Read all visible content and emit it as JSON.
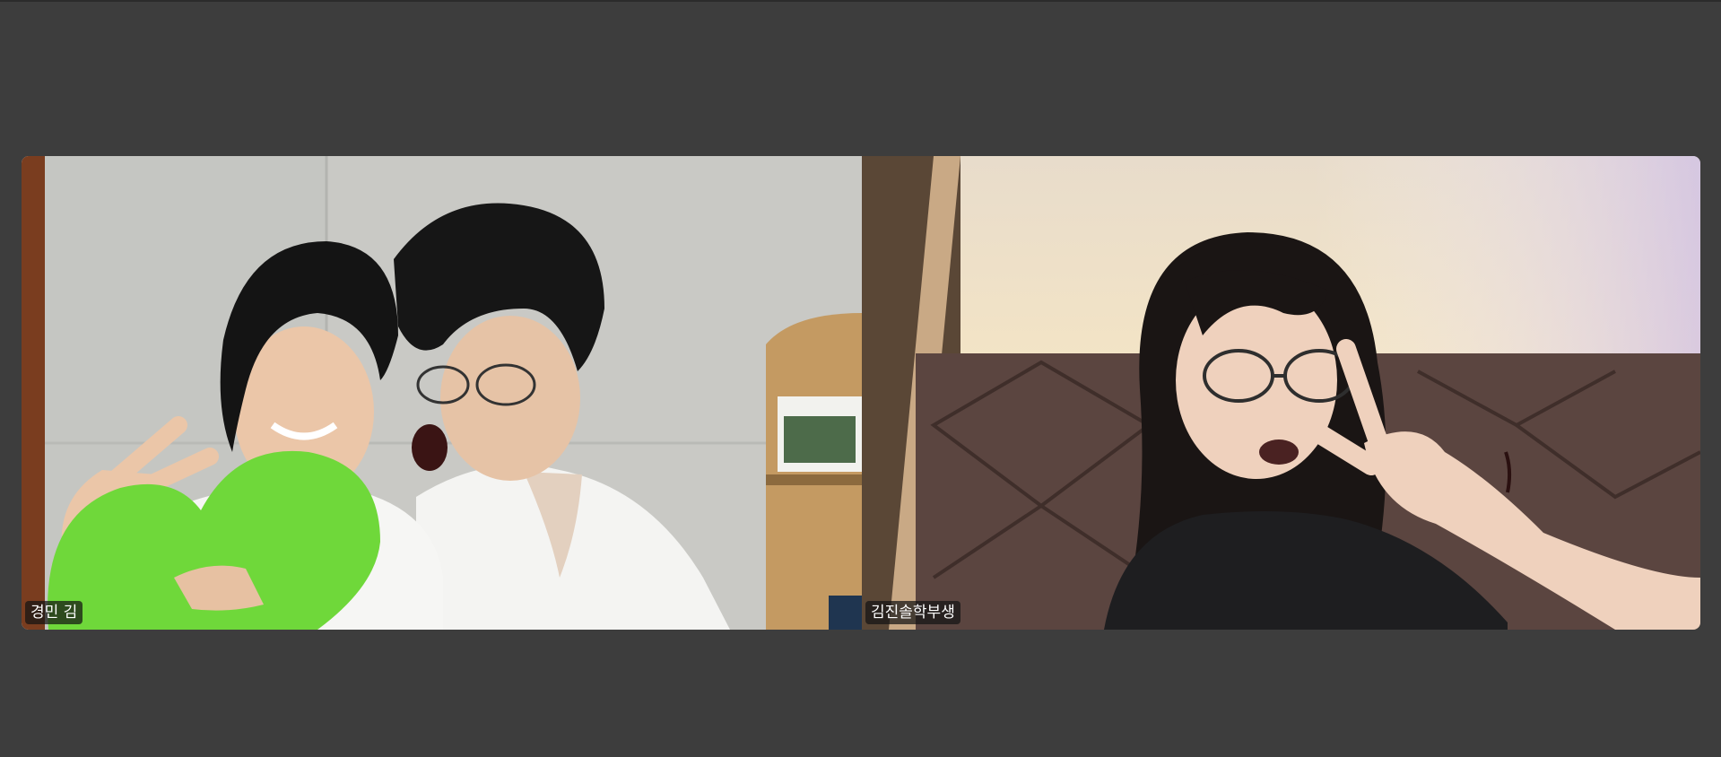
{
  "participants": [
    {
      "display_name": "경민 김"
    },
    {
      "display_name": "김진솔학부생"
    }
  ],
  "colors": {
    "background": "#3d3d3d",
    "name_tag_bg": "rgba(20,20,20,0.72)",
    "name_tag_text": "#ffffff"
  }
}
